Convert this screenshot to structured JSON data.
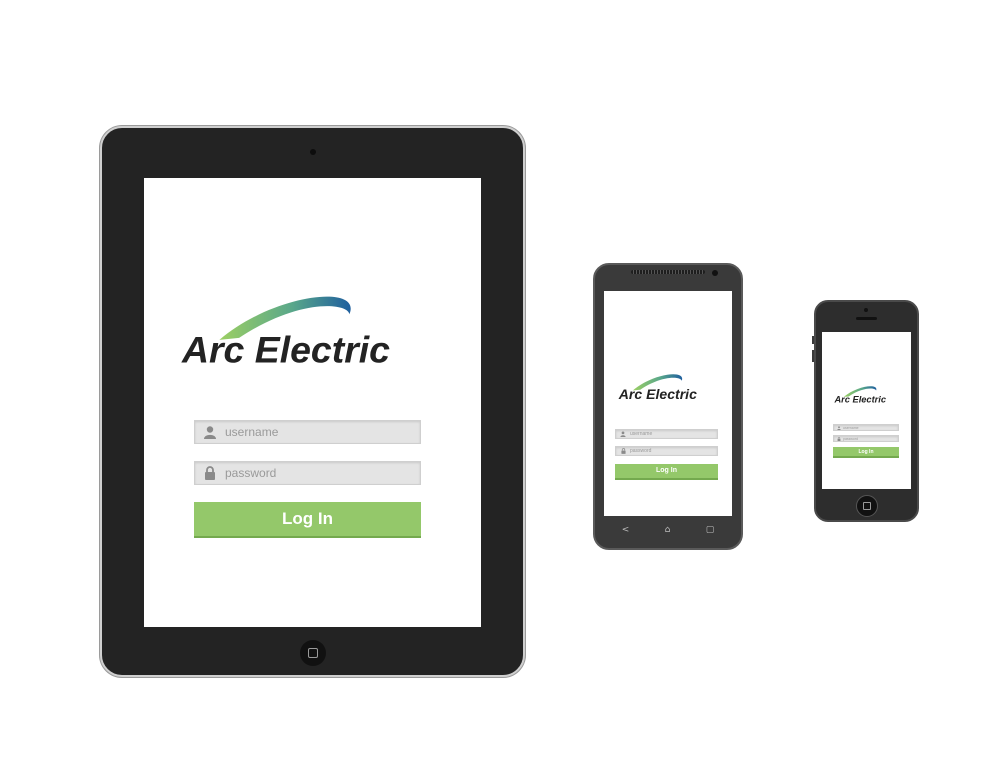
{
  "app": {
    "brand_name": "Arc Electric",
    "brand_colors": {
      "text": "#232323",
      "arc_green": "#8cc657",
      "arc_blue": "#1f5f9e"
    }
  },
  "login": {
    "username_placeholder": "username",
    "password_placeholder": "password",
    "login_label": "Log In",
    "login_color": "#94c86a"
  },
  "devices": [
    {
      "name": "tablet"
    },
    {
      "name": "android-phone",
      "nav_icons": [
        "back-icon",
        "home-icon",
        "recent-apps-icon"
      ]
    },
    {
      "name": "iphone"
    }
  ],
  "android_nav": {
    "back": "<",
    "home": "⌂",
    "recent": "▢"
  }
}
